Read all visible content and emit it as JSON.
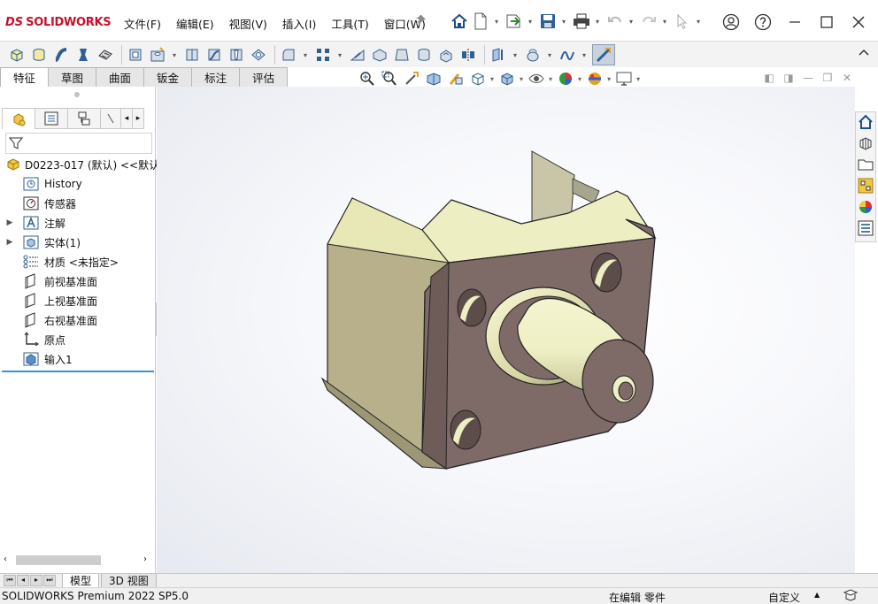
{
  "app": {
    "logo_mark": "DS",
    "logo_text": "SOLIDWORKS"
  },
  "menu": [
    "文件(F)",
    "编辑(E)",
    "视图(V)",
    "插入(I)",
    "工具(T)",
    "窗口(W)"
  ],
  "quick_access_icons": [
    "home-icon",
    "new-document-icon",
    "open-icon",
    "save-icon",
    "print-icon",
    "undo-icon",
    "redo-icon"
  ],
  "window_controls": [
    "user-icon",
    "help-icon",
    "minimize-icon",
    "maximize-icon",
    "close-icon"
  ],
  "ribbon_tabs": [
    {
      "label": "特征",
      "active": true
    },
    {
      "label": "草图",
      "active": false
    },
    {
      "label": "曲面",
      "active": false
    },
    {
      "label": "钣金",
      "active": false
    },
    {
      "label": "标注",
      "active": false
    },
    {
      "label": "评估",
      "active": false
    }
  ],
  "feature_tree": {
    "root": "D0223-017 (默认) <<默认",
    "items": [
      {
        "label": "History",
        "icon": "history-icon",
        "expandable": false
      },
      {
        "label": "传感器",
        "icon": "sensor-icon",
        "expandable": false
      },
      {
        "label": "注解",
        "icon": "annotation-icon",
        "expandable": true
      },
      {
        "label": "实体(1)",
        "icon": "solid-body-icon",
        "expandable": true
      },
      {
        "label": "材质 <未指定>",
        "icon": "material-icon",
        "expandable": false
      },
      {
        "label": "前视基准面",
        "icon": "plane-icon",
        "expandable": false
      },
      {
        "label": "上视基准面",
        "icon": "plane-icon",
        "expandable": false
      },
      {
        "label": "右视基准面",
        "icon": "plane-icon",
        "expandable": false
      },
      {
        "label": "原点",
        "icon": "origin-icon",
        "expandable": false
      },
      {
        "label": "输入1",
        "icon": "imported-body-icon",
        "expandable": false
      }
    ]
  },
  "bottom_tabs": {
    "model": "模型",
    "view3d": "3D 视图"
  },
  "status": {
    "product": "SOLIDWORKS Premium 2022 SP5.0",
    "mode": "在编辑 零件",
    "units": "自定义",
    "units_caret": "▲"
  },
  "colors": {
    "accent": "#c8102e",
    "part_face": "#eeeec3",
    "part_front": "#7e6b68",
    "tree_rule": "#3b8fd6"
  }
}
